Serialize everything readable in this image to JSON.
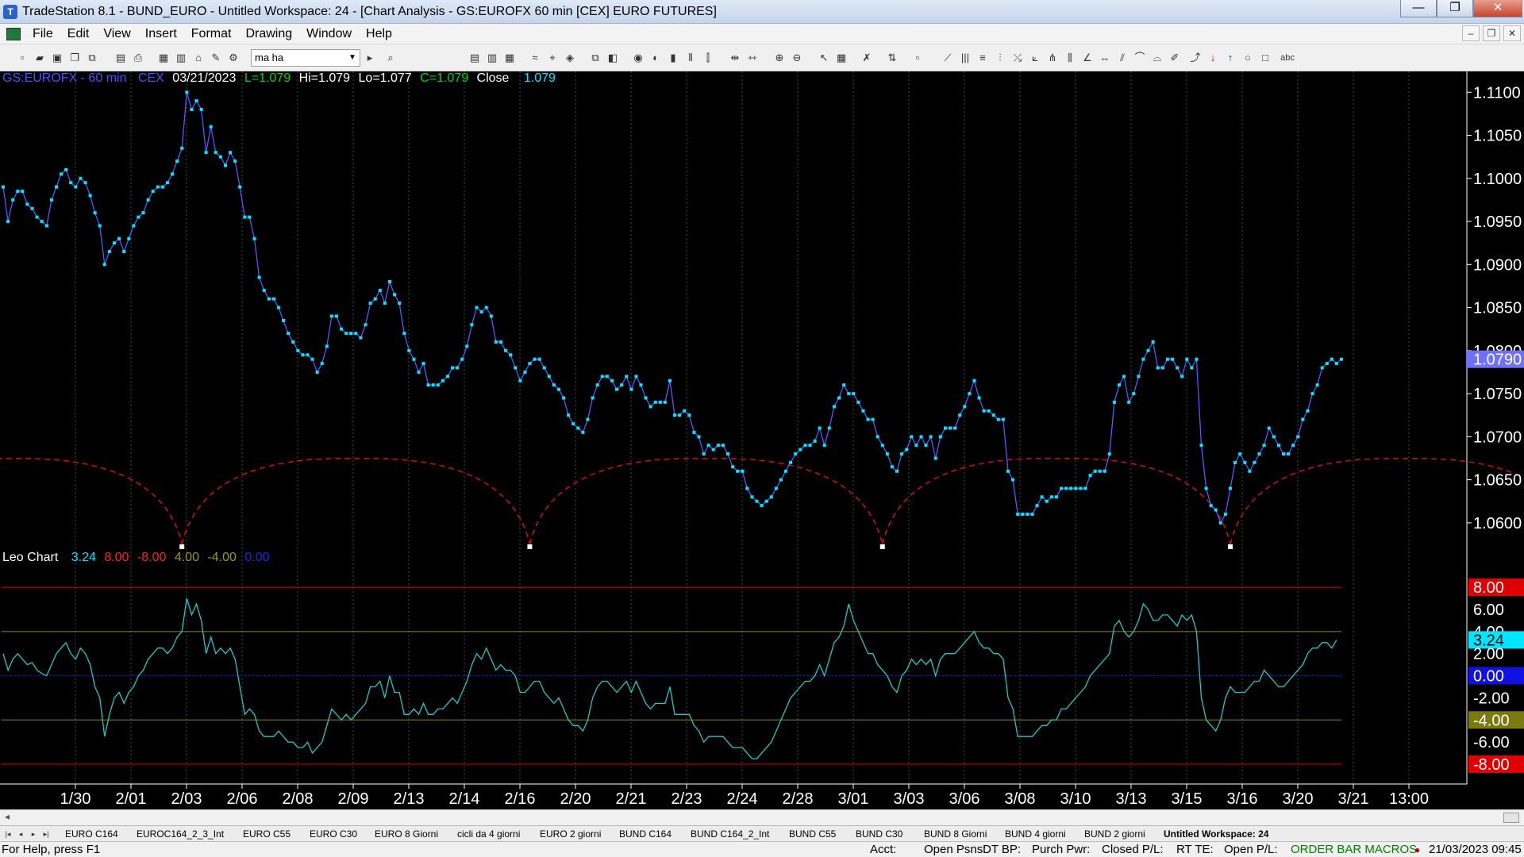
{
  "window": {
    "title": "TradeStation 8.1 - BUND_EURO - Untitled Workspace:  24 - [Chart Analysis - GS:EUROFX  60 min  [CEX] EURO FUTURES]",
    "minimize": "—",
    "maximize": "❐",
    "close": "✕"
  },
  "menu": [
    "File",
    "Edit",
    "View",
    "Insert",
    "Format",
    "Drawing",
    "Window",
    "Help"
  ],
  "mdi": {
    "minimize": "–",
    "restore": "❐",
    "close": "✕"
  },
  "toolbar": {
    "symbol_value": "ma ha"
  },
  "chart_header": {
    "symbol": "GS:EUROFX - 60 min",
    "exchange": "CEX",
    "date": "03/21/2023",
    "last": "L=1.079",
    "high": "Hi=1.079",
    "low": "Lo=1.077",
    "close_eq": "C=1.079",
    "close_label": "Close",
    "close_value": "1.079"
  },
  "indicator_header": {
    "name": "Leo Chart",
    "v1": "3.24",
    "v2": "8.00",
    "v3": "-8.00",
    "v4": "4.00",
    "v5": "-4.00",
    "v6": "0.00"
  },
  "colors": {
    "background": "#000000",
    "price_line": "#5858ff",
    "price_dots": "#00e6ff",
    "cycle_arcs": "#d01010",
    "oscillator": "#20c8c8",
    "level_red": "#e00000",
    "level_olive": "#8a8a20",
    "zero_line": "#1a1ad0"
  },
  "chart_data": [
    {
      "type": "line",
      "title": "GS:EUROFX - 60 min",
      "x_tick_labels": [
        "1/30",
        "2/01",
        "2/03",
        "2/06",
        "2/08",
        "2/09",
        "2/13",
        "2/14",
        "2/16",
        "2/20",
        "2/21",
        "2/23",
        "2/24",
        "2/28",
        "3/01",
        "3/03",
        "3/06",
        "3/08",
        "3/10",
        "3/13",
        "3/15",
        "3/16",
        "3/20",
        "3/21",
        "13:00"
      ],
      "y_tick_labels": [
        "1.0600",
        "1.0650",
        "1.0700",
        "1.0750",
        "1.0800",
        "1.0850",
        "1.0900",
        "1.0950",
        "1.1000",
        "1.1050",
        "1.1100"
      ],
      "ylim": [
        1.0575,
        1.1115
      ],
      "last_value_label": "1.0790",
      "series": [
        {
          "name": "Close",
          "values": [
            1.099,
            1.095,
            1.0975,
            1.0985,
            1.0985,
            1.097,
            1.0965,
            1.0955,
            1.095,
            1.0945,
            1.0975,
            1.099,
            1.1005,
            1.101,
            1.0995,
            1.099,
            1.1,
            1.0995,
            1.098,
            1.096,
            1.0945,
            1.09,
            1.0915,
            1.0925,
            1.093,
            1.0915,
            1.093,
            1.0945,
            1.0955,
            1.096,
            1.0975,
            1.0985,
            1.099,
            1.099,
            1.0995,
            1.1005,
            1.102,
            1.1035,
            1.11,
            1.108,
            1.109,
            1.108,
            1.103,
            1.106,
            1.103,
            1.1025,
            1.1015,
            1.103,
            1.102,
            1.099,
            1.0955,
            1.0955,
            1.093,
            1.0885,
            1.087,
            1.086,
            1.086,
            1.085,
            1.0835,
            1.082,
            1.081,
            1.08,
            1.0795,
            1.0795,
            1.079,
            1.0775,
            1.0785,
            1.0805,
            1.084,
            1.084,
            1.0825,
            1.082,
            1.082,
            1.082,
            1.0815,
            1.083,
            1.0855,
            1.086,
            1.087,
            1.0855,
            1.088,
            1.0865,
            1.0855,
            1.082,
            1.08,
            1.079,
            1.0775,
            1.0785,
            1.076,
            1.076,
            1.076,
            1.0765,
            1.077,
            1.078,
            1.078,
            1.079,
            1.0805,
            1.083,
            1.085,
            1.0845,
            1.085,
            1.084,
            1.081,
            1.081,
            1.08,
            1.0795,
            1.078,
            1.0765,
            1.0775,
            1.0785,
            1.079,
            1.079,
            1.078,
            1.077,
            1.076,
            1.0755,
            1.0745,
            1.0725,
            1.0715,
            1.071,
            1.0705,
            1.072,
            1.0745,
            1.076,
            1.077,
            1.077,
            1.0765,
            1.0755,
            1.076,
            1.077,
            1.0755,
            1.077,
            1.076,
            1.0745,
            1.0735,
            1.074,
            1.074,
            1.074,
            1.0765,
            1.0725,
            1.0725,
            1.073,
            1.0725,
            1.0705,
            1.07,
            1.068,
            1.069,
            1.0685,
            1.069,
            1.069,
            1.068,
            1.0665,
            1.066,
            1.066,
            1.064,
            1.063,
            1.0625,
            1.062,
            1.0625,
            1.063,
            1.064,
            1.065,
            1.066,
            1.067,
            1.068,
            1.0685,
            1.069,
            1.069,
            1.0695,
            1.071,
            1.069,
            1.071,
            1.0735,
            1.0745,
            1.076,
            1.075,
            1.075,
            1.074,
            1.073,
            1.072,
            1.072,
            1.07,
            1.069,
            1.068,
            1.0665,
            1.066,
            1.068,
            1.0685,
            1.07,
            1.069,
            1.07,
            1.069,
            1.07,
            1.0675,
            1.07,
            1.071,
            1.071,
            1.071,
            1.0725,
            1.0735,
            1.075,
            1.0765,
            1.0745,
            1.073,
            1.073,
            1.0725,
            1.072,
            1.072,
            1.066,
            1.065,
            1.061,
            1.061,
            1.061,
            1.061,
            1.062,
            1.063,
            1.0625,
            1.063,
            1.063,
            1.064,
            1.064,
            1.064,
            1.064,
            1.064,
            1.064,
            1.0655,
            1.066,
            1.066,
            1.066,
            1.068,
            1.074,
            1.076,
            1.077,
            1.074,
            1.075,
            1.077,
            1.079,
            1.08,
            1.081,
            1.078,
            1.078,
            1.079,
            1.079,
            1.078,
            1.077,
            1.079,
            1.078,
            1.079,
            1.069,
            1.064,
            1.062,
            1.0615,
            1.06,
            1.061,
            1.064,
            1.067,
            1.068,
            1.067,
            1.066,
            1.067,
            1.068,
            1.069,
            1.071,
            1.07,
            1.069,
            1.068,
            1.068,
            1.069,
            1.07,
            1.072,
            1.073,
            1.075,
            1.076,
            1.078,
            1.0785,
            1.079,
            1.0785,
            1.079
          ]
        }
      ],
      "cycle_lows_at_index": [
        37,
        109,
        182,
        254,
        326
      ]
    },
    {
      "type": "line",
      "title": "Leo Chart",
      "y_tick_labels": [
        "8.00",
        "6.00",
        "4.00",
        "3.24",
        "2.00",
        "0.00",
        "-2.00",
        "-4.00",
        "-6.00",
        "-8.00"
      ],
      "ylim": [
        -8.5,
        9.3
      ],
      "levels": [
        8.0,
        4.0,
        0.0,
        -4.0,
        -8.0
      ],
      "series": [
        {
          "name": "Leo Chart",
          "values": [
            2.0,
            0.5,
            1.5,
            2.0,
            1.5,
            1.0,
            1.2,
            0.5,
            0.2,
            0.0,
            1.0,
            2.0,
            2.5,
            3.0,
            2.0,
            1.5,
            2.5,
            2.0,
            1.0,
            -1.0,
            -2.0,
            -5.5,
            -3.5,
            -2.0,
            -1.5,
            -2.5,
            -1.5,
            -1.0,
            0.0,
            0.5,
            1.5,
            2.0,
            2.5,
            2.5,
            2.0,
            2.5,
            3.5,
            4.0,
            7.0,
            5.5,
            6.5,
            5.0,
            2.0,
            3.5,
            2.0,
            2.5,
            2.0,
            2.5,
            1.5,
            -1.0,
            -3.5,
            -3.0,
            -3.5,
            -5.0,
            -5.5,
            -5.5,
            -5.5,
            -5.0,
            -5.5,
            -6.0,
            -6.0,
            -6.5,
            -6.5,
            -6.0,
            -7.0,
            -6.5,
            -6.0,
            -4.5,
            -3.0,
            -3.5,
            -4.0,
            -3.5,
            -4.0,
            -3.5,
            -3.0,
            -2.5,
            -1.0,
            -1.0,
            -0.5,
            -2.0,
            0.0,
            -1.5,
            -1.5,
            -3.5,
            -3.5,
            -3.0,
            -3.5,
            -2.5,
            -3.5,
            -3.5,
            -3.0,
            -3.0,
            -2.5,
            -2.0,
            -2.5,
            -1.5,
            -0.5,
            1.0,
            2.0,
            1.5,
            2.5,
            1.5,
            0.5,
            1.0,
            0.5,
            0.5,
            0.0,
            -1.5,
            -1.5,
            -1.0,
            -0.5,
            -0.5,
            -1.5,
            -2.0,
            -2.5,
            -2.0,
            -3.0,
            -4.0,
            -4.5,
            -4.5,
            -5.0,
            -4.0,
            -2.0,
            -1.0,
            -0.5,
            -0.5,
            -1.0,
            -1.5,
            -1.0,
            -0.5,
            -1.5,
            -0.5,
            -1.5,
            -2.5,
            -3.0,
            -2.5,
            -2.5,
            -2.5,
            -1.0,
            -3.5,
            -3.5,
            -3.5,
            -3.5,
            -4.5,
            -5.0,
            -6.0,
            -5.5,
            -5.5,
            -5.5,
            -5.5,
            -6.0,
            -6.5,
            -6.5,
            -6.5,
            -7.0,
            -7.5,
            -7.5,
            -7.0,
            -6.5,
            -6.0,
            -5.0,
            -4.0,
            -3.0,
            -2.0,
            -1.5,
            -1.0,
            -0.5,
            -0.5,
            0.0,
            1.0,
            0.0,
            1.5,
            3.0,
            3.5,
            4.5,
            6.5,
            5.0,
            4.0,
            3.0,
            2.0,
            2.0,
            1.0,
            0.5,
            0.0,
            -1.0,
            -1.5,
            0.0,
            0.5,
            1.5,
            1.0,
            1.5,
            1.0,
            1.5,
            0.0,
            1.5,
            2.0,
            2.0,
            2.0,
            2.5,
            3.0,
            3.5,
            4.0,
            3.0,
            2.5,
            2.5,
            2.0,
            2.0,
            1.5,
            -2.0,
            -3.0,
            -5.5,
            -5.5,
            -5.5,
            -5.5,
            -5.0,
            -4.5,
            -4.5,
            -4.0,
            -4.0,
            -3.0,
            -3.0,
            -2.5,
            -2.0,
            -1.5,
            -1.0,
            0.0,
            0.5,
            1.0,
            1.5,
            2.0,
            4.5,
            5.0,
            4.0,
            3.5,
            4.0,
            5.0,
            6.5,
            6.0,
            5.0,
            5.0,
            5.5,
            5.5,
            5.0,
            4.5,
            5.5,
            5.0,
            5.5,
            4.0,
            -2.0,
            -4.0,
            -4.5,
            -5.0,
            -4.0,
            -2.0,
            -1.0,
            -1.5,
            -1.5,
            -1.5,
            -1.0,
            -0.5,
            -0.5,
            0.5,
            0.0,
            -0.5,
            -1.0,
            -1.0,
            -0.5,
            0.0,
            0.5,
            1.0,
            2.0,
            2.5,
            2.5,
            3.0,
            3.0,
            2.5,
            3.24
          ]
        }
      ]
    }
  ],
  "tabs": [
    "EURO C164",
    "EUROC164_2_3_Int",
    "EURO C55",
    "EURO C30",
    "EURO 8 Giorni",
    "cicli da 4 giorni",
    "EURO 2 giorni",
    "BUND C164",
    "BUND C164_2_Int",
    "BUND C55",
    "BUND  C30",
    "BUND 8 Giorni",
    "BUND 4 giorni",
    "BUND 2 giorni",
    "Untitled Workspace:  24"
  ],
  "status": {
    "help": "For Help, press F1",
    "acct": "Acct:",
    "open_psns": "Open Psns:",
    "dt_bp": "DT BP:",
    "purch_pwr": "Purch Pwr:",
    "closed_pl": "Closed P/L:",
    "rt_te": "RT TE:",
    "open_pl": "Open P/L:",
    "macros": "ORDER BAR  MACROS",
    "datetime": "21/03/2023 09:45"
  }
}
